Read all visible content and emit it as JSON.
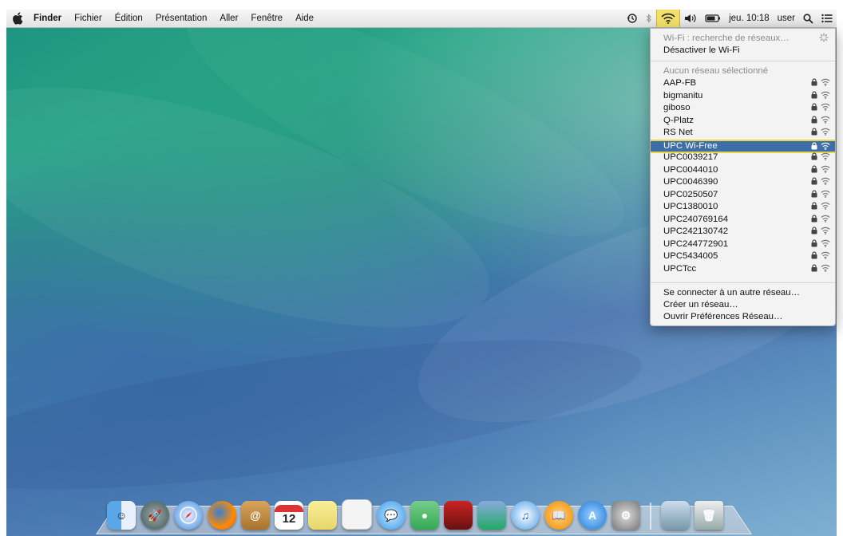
{
  "menubar": {
    "app_name": "Finder",
    "menus": [
      "Fichier",
      "Édition",
      "Présentation",
      "Aller",
      "Fenêtre",
      "Aide"
    ],
    "clock": "jeu. 10:18",
    "user": "user"
  },
  "wifi_menu": {
    "status": "Wi-Fi : recherche de réseaux…",
    "toggle": "Désactiver le Wi-Fi",
    "none_selected": "Aucun réseau sélectionné",
    "networks": [
      "AAP-FB",
      "bigmanitu",
      "giboso",
      "Q-Platz",
      "RS Net",
      "UPC Wi-Free",
      "UPC0039217",
      "UPC0044010",
      "UPC0046390",
      "UPC0250507",
      "UPC1380010",
      "UPC240769164",
      "UPC242130742",
      "UPC244772901",
      "UPC5434005",
      "UPCTcc"
    ],
    "selected_network": "UPC Wi-Free",
    "other_network": "Se connecter à un autre réseau…",
    "create_network": "Créer un réseau…",
    "open_prefs": "Ouvrir Préférences Réseau…"
  },
  "dock": {
    "calendar_day": "12"
  },
  "colors": {
    "menu_highlight": "#3d6ea8",
    "wifi_status_bg": "#f3e06a"
  }
}
